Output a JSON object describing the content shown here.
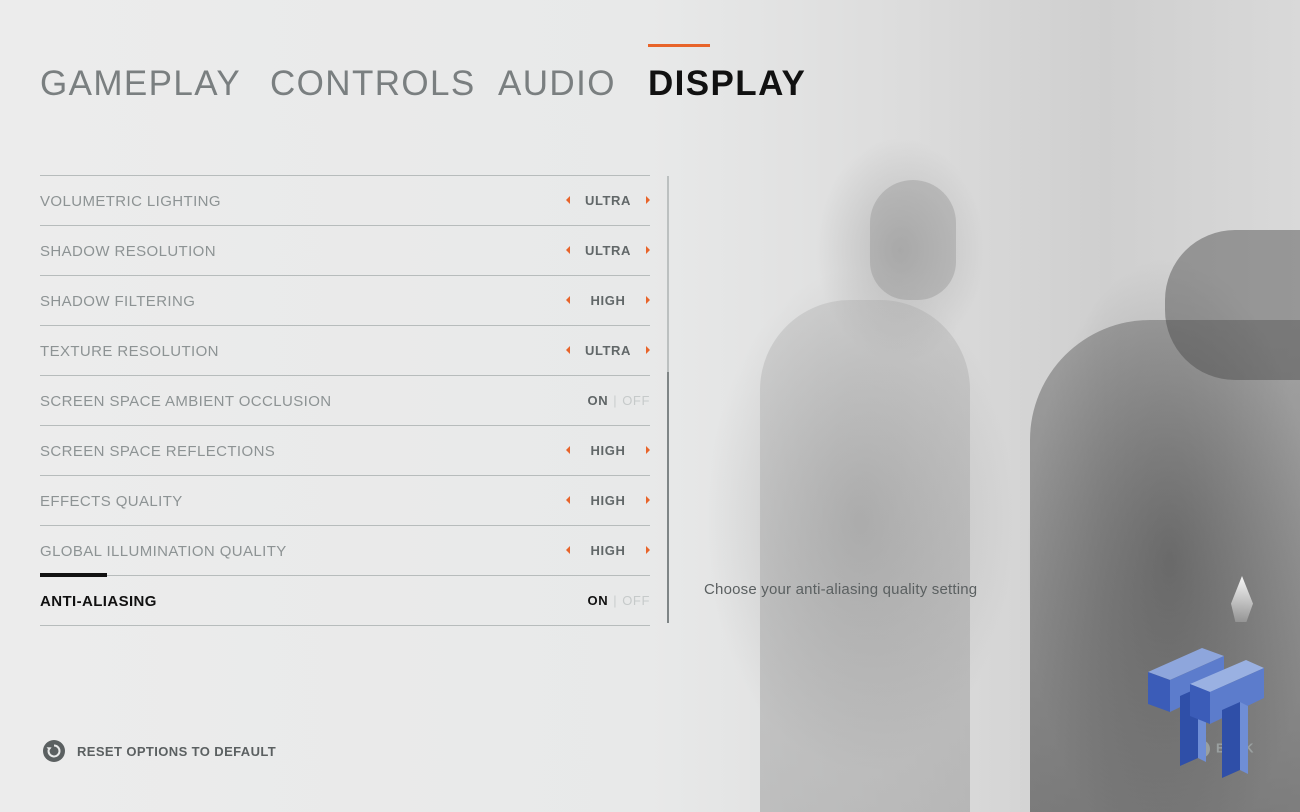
{
  "tabs": [
    {
      "label": "GAMEPLAY",
      "active": false
    },
    {
      "label": "CONTROLS",
      "active": false
    },
    {
      "label": "AUDIO",
      "active": false
    },
    {
      "label": "DISPLAY",
      "active": true
    }
  ],
  "settings": [
    {
      "label": "VOLUMETRIC LIGHTING",
      "type": "selector",
      "value": "ULTRA"
    },
    {
      "label": "SHADOW RESOLUTION",
      "type": "selector",
      "value": "ULTRA"
    },
    {
      "label": "SHADOW FILTERING",
      "type": "selector",
      "value": "HIGH"
    },
    {
      "label": "TEXTURE RESOLUTION",
      "type": "selector",
      "value": "ULTRA"
    },
    {
      "label": "SCREEN SPACE AMBIENT OCCLUSION",
      "type": "toggle",
      "on_label": "ON",
      "off_label": "OFF",
      "value": "ON"
    },
    {
      "label": "SCREEN SPACE REFLECTIONS",
      "type": "selector",
      "value": "HIGH"
    },
    {
      "label": "EFFECTS QUALITY",
      "type": "selector",
      "value": "HIGH"
    },
    {
      "label": "GLOBAL ILLUMINATION QUALITY",
      "type": "selector",
      "value": "HIGH"
    },
    {
      "label": "ANTI-ALIASING",
      "type": "toggle",
      "on_label": "ON",
      "off_label": "OFF",
      "value": "ON",
      "selected": true
    }
  ],
  "description": "Choose your anti-aliasing quality setting",
  "reset_label": "RESET OPTIONS TO DEFAULT",
  "back_label": "BACK",
  "icons": {
    "reset": "reset-icon",
    "arrow_left": "arrow-left-icon",
    "arrow_right": "arrow-right-icon",
    "back": "back-button-icon",
    "watermark": "tt-logo-watermark"
  },
  "colors": {
    "accent": "#e8642a",
    "active_text": "#111111",
    "inactive_tab": "#7a7f80",
    "row_label": "#8d9394"
  }
}
